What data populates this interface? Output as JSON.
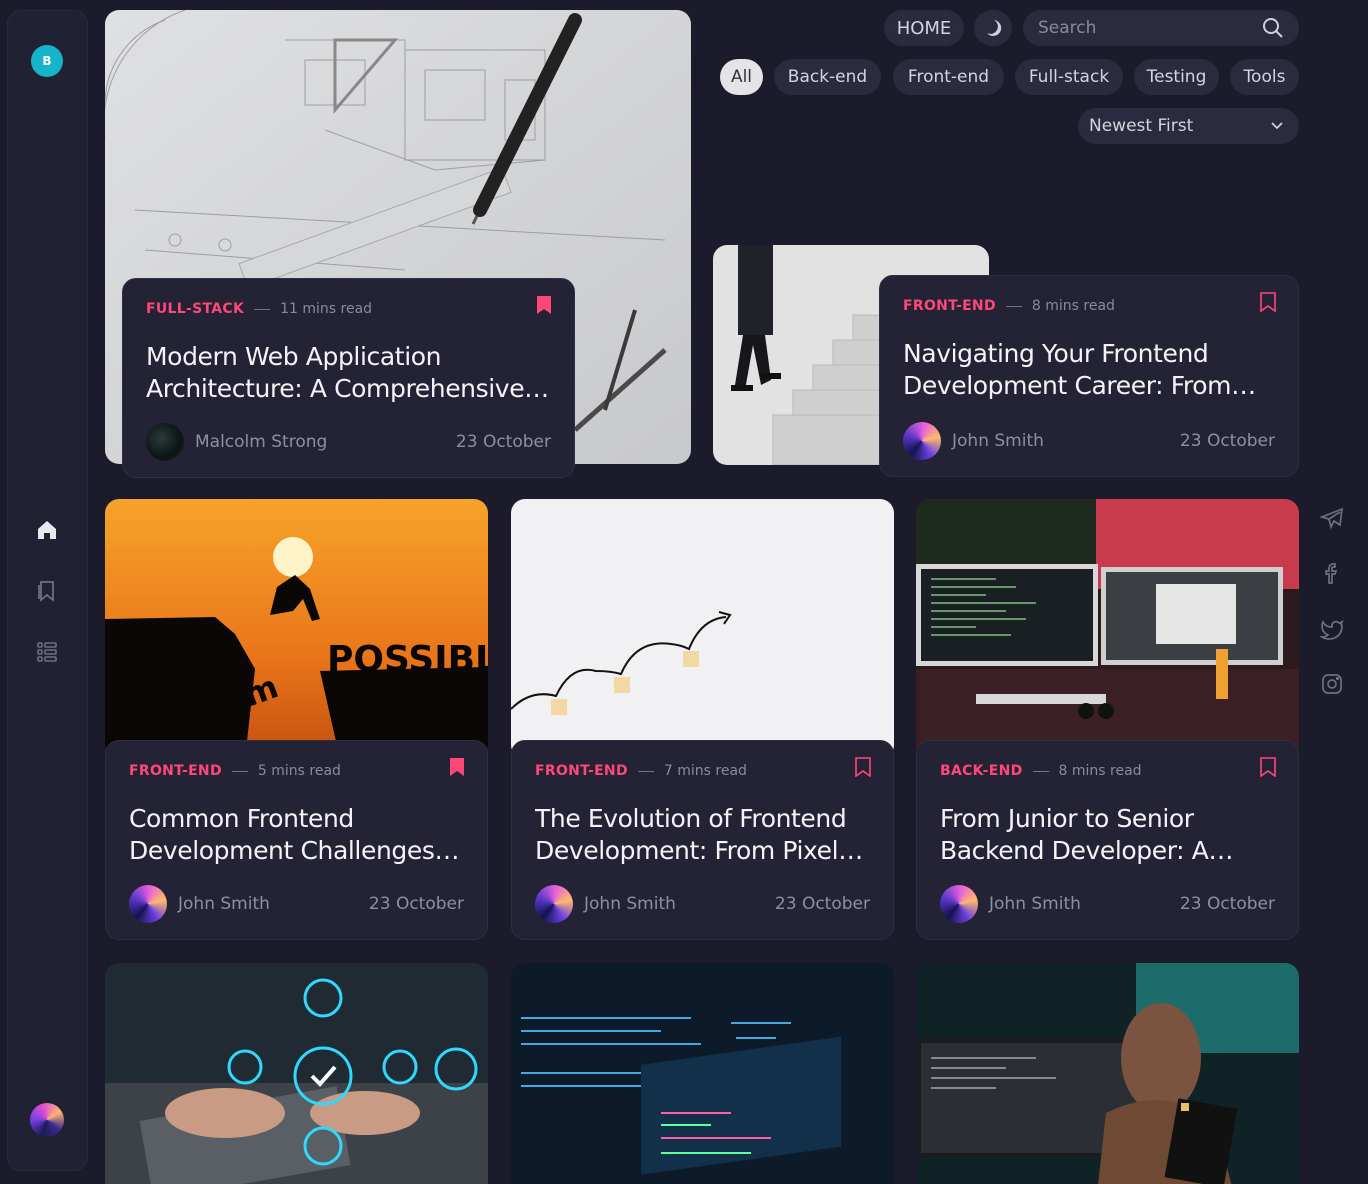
{
  "sidebar": {
    "logo_letter": "B",
    "nav": [
      "home-icon",
      "bookmarks-icon",
      "list-icon"
    ]
  },
  "header": {
    "home_label": "HOME",
    "search_placeholder": "Search",
    "filters": [
      "All",
      "Back-end",
      "Front-end",
      "Full-stack",
      "Testing",
      "Tools"
    ],
    "active_filter": "All",
    "sort_label": "Newest First"
  },
  "posts": [
    {
      "category": "FULL-STACK",
      "read_time": "11 mins read",
      "title": "Modern Web Application Architecture: A Comprehensive Guide",
      "author": "Malcolm Strong",
      "date": "23 October",
      "bookmarked": true
    },
    {
      "category": "FRONT-END",
      "read_time": "8 mins read",
      "title": "Navigating Your Frontend Development Career: From Junior to Senior",
      "author": "John Smith",
      "date": "23 October",
      "bookmarked": false
    },
    {
      "category": "FRONT-END",
      "read_time": "5 mins read",
      "title": "Common Frontend Development Challenges and Solutions",
      "author": "John Smith",
      "date": "23 October",
      "bookmarked": true
    },
    {
      "category": "FRONT-END",
      "read_time": "7 mins read",
      "title": "The Evolution of Frontend Development: From Pixels to Components",
      "author": "John Smith",
      "date": "23 October",
      "bookmarked": false
    },
    {
      "category": "BACK-END",
      "read_time": "8 mins read",
      "title": "From Junior to Senior Backend Developer: A Roadmap",
      "author": "John Smith",
      "date": "23 October",
      "bookmarked": false
    }
  ],
  "social": [
    "telegram-icon",
    "facebook-icon",
    "twitter-icon",
    "instagram-icon"
  ],
  "colors": {
    "background": "#1b1b2b",
    "card": "#232335",
    "accent": "#ff4778",
    "pill": "#2b2b3f"
  }
}
